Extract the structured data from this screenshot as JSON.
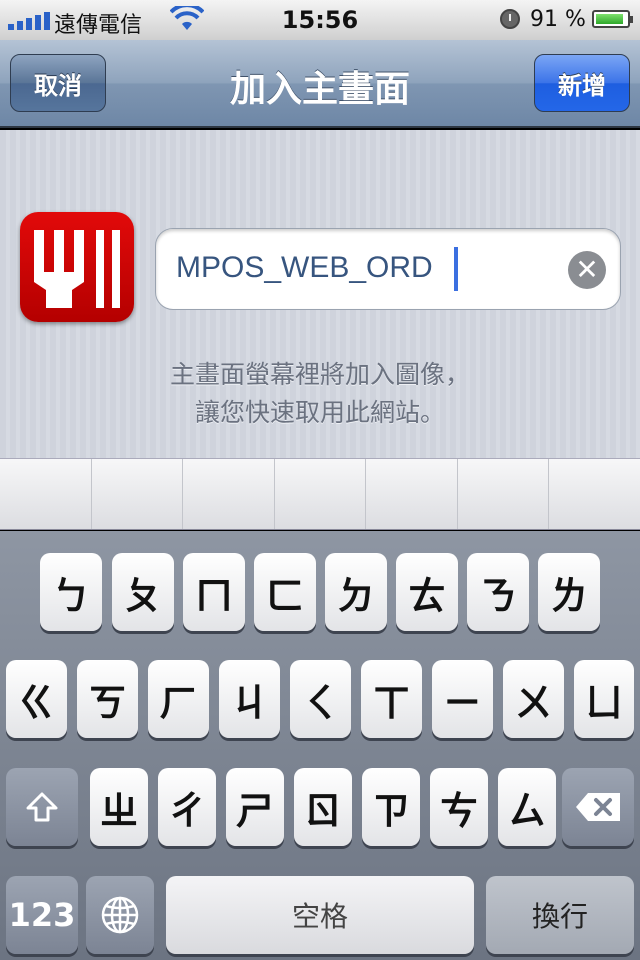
{
  "status_bar": {
    "carrier": "遠傳電信",
    "time": "15:56",
    "battery_percent": "91 %",
    "battery_level": 0.91
  },
  "nav_bar": {
    "title": "加入主畫面",
    "cancel_label": "取消",
    "add_label": "新增"
  },
  "bookmark": {
    "name_value": "MPOS_WEB_ORD",
    "clear_glyph": "✕",
    "hint_line1": "主畫面螢幕裡將加入圖像，",
    "hint_line2": "讓您快速取用此網站。"
  },
  "keyboard": {
    "row1": [
      "ㄅ",
      "ㄆ",
      "ㄇ",
      "ㄈ",
      "ㄉ",
      "ㄊ",
      "ㄋ",
      "ㄌ"
    ],
    "row2": [
      "ㄍ",
      "ㄎ",
      "ㄏ",
      "ㄐ",
      "ㄑ",
      "ㄒ",
      "ㄧ",
      "ㄨ",
      "ㄩ"
    ],
    "row3": [
      "ㄓ",
      "ㄔ",
      "ㄕ",
      "ㄖ",
      "ㄗ",
      "ㄘ",
      "ㄙ"
    ],
    "numbers_label": "123",
    "space_label": "空格",
    "return_label": "換行"
  },
  "colors": {
    "accent_blue": "#2467e8",
    "icon_red": "#c80000"
  },
  "icons": [
    "signal-icon",
    "wifi-icon",
    "clock-icon",
    "battery-icon",
    "clear-icon",
    "shift-icon",
    "delete-icon",
    "globe-icon",
    "app-icon"
  ]
}
